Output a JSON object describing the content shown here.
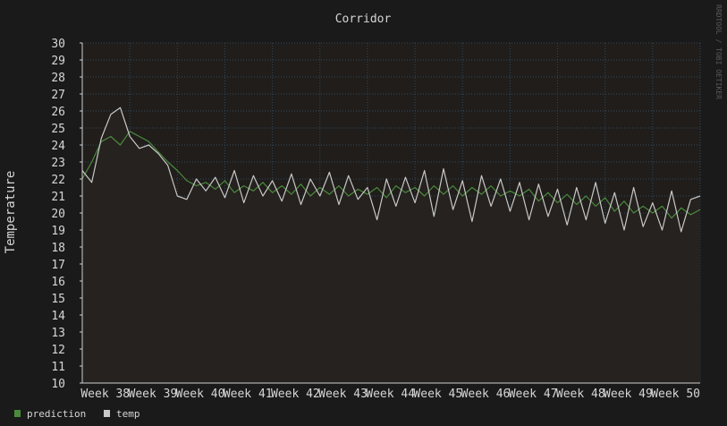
{
  "chart_data": {
    "type": "line",
    "title": "Corridor",
    "ylabel": "Temperature",
    "xlabel": "",
    "watermark": "RRDTOOL / TOBI OETIKER",
    "ylim": [
      10,
      30
    ],
    "yticks": [
      10,
      11,
      12,
      13,
      14,
      15,
      16,
      17,
      18,
      19,
      20,
      21,
      22,
      23,
      24,
      25,
      26,
      27,
      28,
      29,
      30
    ],
    "xlim": [
      37,
      50
    ],
    "xticks": [
      {
        "x": 38,
        "label": "Week 38"
      },
      {
        "x": 39,
        "label": "Week 39"
      },
      {
        "x": 40,
        "label": "Week 40"
      },
      {
        "x": 41,
        "label": "Week 41"
      },
      {
        "x": 42,
        "label": "Week 42"
      },
      {
        "x": 43,
        "label": "Week 43"
      },
      {
        "x": 44,
        "label": "Week 44"
      },
      {
        "x": 45,
        "label": "Week 45"
      },
      {
        "x": 46,
        "label": "Week 46"
      },
      {
        "x": 47,
        "label": "Week 47"
      },
      {
        "x": 48,
        "label": "Week 48"
      },
      {
        "x": 49,
        "label": "Week 49"
      },
      {
        "x": 50,
        "label": "Week 50"
      }
    ],
    "grid": true,
    "legend_position": "bottom-left",
    "colors": {
      "background": "#1a1a1a",
      "plot": "#201d1b",
      "grid": "#2f4a5e",
      "axis": "#cfcfcf"
    },
    "series": [
      {
        "name": "prediction",
        "color": "#4a8a3c",
        "x": [
          37.0,
          37.2,
          37.4,
          37.6,
          37.8,
          38.0,
          38.2,
          38.4,
          38.6,
          38.8,
          39.0,
          39.2,
          39.4,
          39.6,
          39.8,
          40.0,
          40.2,
          40.4,
          40.6,
          40.8,
          41.0,
          41.2,
          41.4,
          41.6,
          41.8,
          42.0,
          42.2,
          42.4,
          42.6,
          42.8,
          43.0,
          43.2,
          43.4,
          43.6,
          43.8,
          44.0,
          44.2,
          44.4,
          44.6,
          44.8,
          45.0,
          45.2,
          45.4,
          45.6,
          45.8,
          46.0,
          46.2,
          46.4,
          46.6,
          46.8,
          47.0,
          47.2,
          47.4,
          47.6,
          47.8,
          48.0,
          48.2,
          48.4,
          48.6,
          48.8,
          49.0,
          49.2,
          49.4,
          49.6,
          49.8,
          50.0
        ],
        "y": [
          22.0,
          23.0,
          24.2,
          24.5,
          24.0,
          24.8,
          24.5,
          24.2,
          23.6,
          23.0,
          22.5,
          21.9,
          21.6,
          21.8,
          21.4,
          21.9,
          21.2,
          21.6,
          21.3,
          21.8,
          21.2,
          21.6,
          21.1,
          21.7,
          21.0,
          21.5,
          21.1,
          21.6,
          21.0,
          21.4,
          21.1,
          21.5,
          20.9,
          21.6,
          21.2,
          21.5,
          21.0,
          21.6,
          21.1,
          21.6,
          21.0,
          21.5,
          21.1,
          21.6,
          21.0,
          21.3,
          21.0,
          21.4,
          20.7,
          21.2,
          20.6,
          21.1,
          20.5,
          21.0,
          20.4,
          20.9,
          20.1,
          20.7,
          20.0,
          20.4,
          20.0,
          20.4,
          19.7,
          20.3,
          19.9,
          20.2
        ]
      },
      {
        "name": "temp",
        "color": "#c8c8c8",
        "x": [
          37.0,
          37.2,
          37.4,
          37.6,
          37.8,
          38.0,
          38.2,
          38.4,
          38.6,
          38.8,
          39.0,
          39.2,
          39.4,
          39.6,
          39.8,
          40.0,
          40.2,
          40.4,
          40.6,
          40.8,
          41.0,
          41.2,
          41.4,
          41.6,
          41.8,
          42.0,
          42.2,
          42.4,
          42.6,
          42.8,
          43.0,
          43.2,
          43.4,
          43.6,
          43.8,
          44.0,
          44.2,
          44.4,
          44.6,
          44.8,
          45.0,
          45.2,
          45.4,
          45.6,
          45.8,
          46.0,
          46.2,
          46.4,
          46.6,
          46.8,
          47.0,
          47.2,
          47.4,
          47.6,
          47.8,
          48.0,
          48.2,
          48.4,
          48.6,
          48.8,
          49.0,
          49.2,
          49.4,
          49.6,
          49.8,
          50.0
        ],
        "y": [
          22.5,
          21.8,
          24.4,
          25.8,
          26.2,
          24.5,
          23.8,
          24.0,
          23.5,
          22.8,
          21.0,
          20.8,
          22.0,
          21.3,
          22.1,
          20.9,
          22.5,
          20.6,
          22.2,
          21.0,
          21.9,
          20.7,
          22.3,
          20.5,
          22.0,
          21.0,
          22.4,
          20.5,
          22.2,
          20.8,
          21.5,
          19.6,
          22.0,
          20.4,
          22.1,
          20.6,
          22.5,
          19.8,
          22.6,
          20.2,
          21.9,
          19.5,
          22.2,
          20.4,
          22.0,
          20.1,
          21.8,
          19.6,
          21.7,
          19.8,
          21.4,
          19.3,
          21.5,
          19.6,
          21.8,
          19.4,
          21.2,
          19.0,
          21.5,
          19.2,
          20.6,
          19.0,
          21.3,
          18.9,
          20.8,
          21.0
        ]
      }
    ]
  }
}
